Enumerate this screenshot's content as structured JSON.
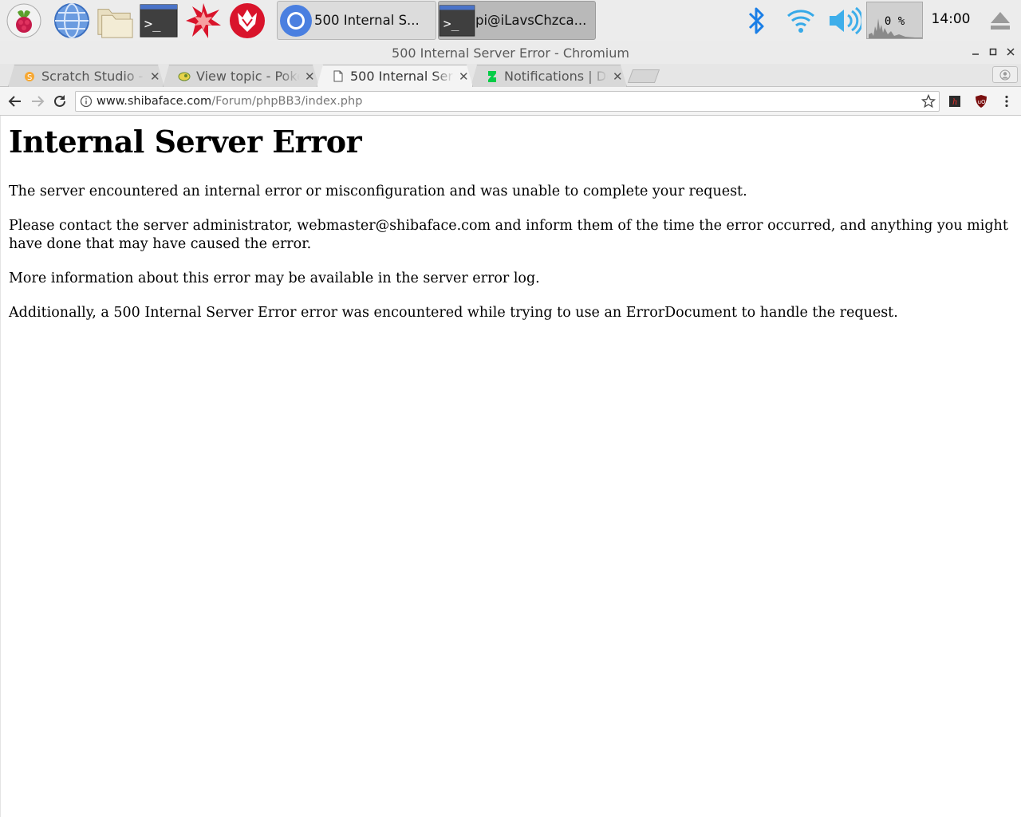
{
  "taskbar": {
    "launchers": [
      "raspberry-menu",
      "web-browser",
      "file-manager",
      "terminal",
      "wolfram-mathematica",
      "wolfram-language"
    ],
    "tasks": [
      {
        "label": "500 Internal S...",
        "active": false
      },
      {
        "label": "pi@iLavsChzca...",
        "active": true
      }
    ],
    "cpu_usage": "0 %",
    "clock": "14:00"
  },
  "window": {
    "title": "500 Internal Server Error - Chromium"
  },
  "tabs": [
    {
      "label": "Scratch Studio - ",
      "icon": "scratch-favicon"
    },
    {
      "label": "View topic - Poke",
      "icon": "forum-favicon"
    },
    {
      "label": "500 Internal Ser",
      "icon": "document-favicon",
      "active": true
    },
    {
      "label": "Notifications | De",
      "icon": "deviantart-favicon"
    }
  ],
  "toolbar": {
    "url_host": "www.shibaface.com",
    "url_path": "/Forum/phpBB3/index.php"
  },
  "page": {
    "heading": "Internal Server Error",
    "p1": "The server encountered an internal error or misconfiguration and was unable to complete your request.",
    "p2": "Please contact the server administrator, webmaster@shibaface.com and inform them of the time the error occurred, and anything you might have done that may have caused the error.",
    "p3": "More information about this error may be available in the server error log.",
    "p4": "Additionally, a 500 Internal Server Error error was encountered while trying to use an ErrorDocument to handle the request."
  },
  "colors": {
    "chrome_blue": "#4a7fe0",
    "wolfram_red": "#d9142b",
    "bluetooth_blue": "#1a7ee6"
  }
}
